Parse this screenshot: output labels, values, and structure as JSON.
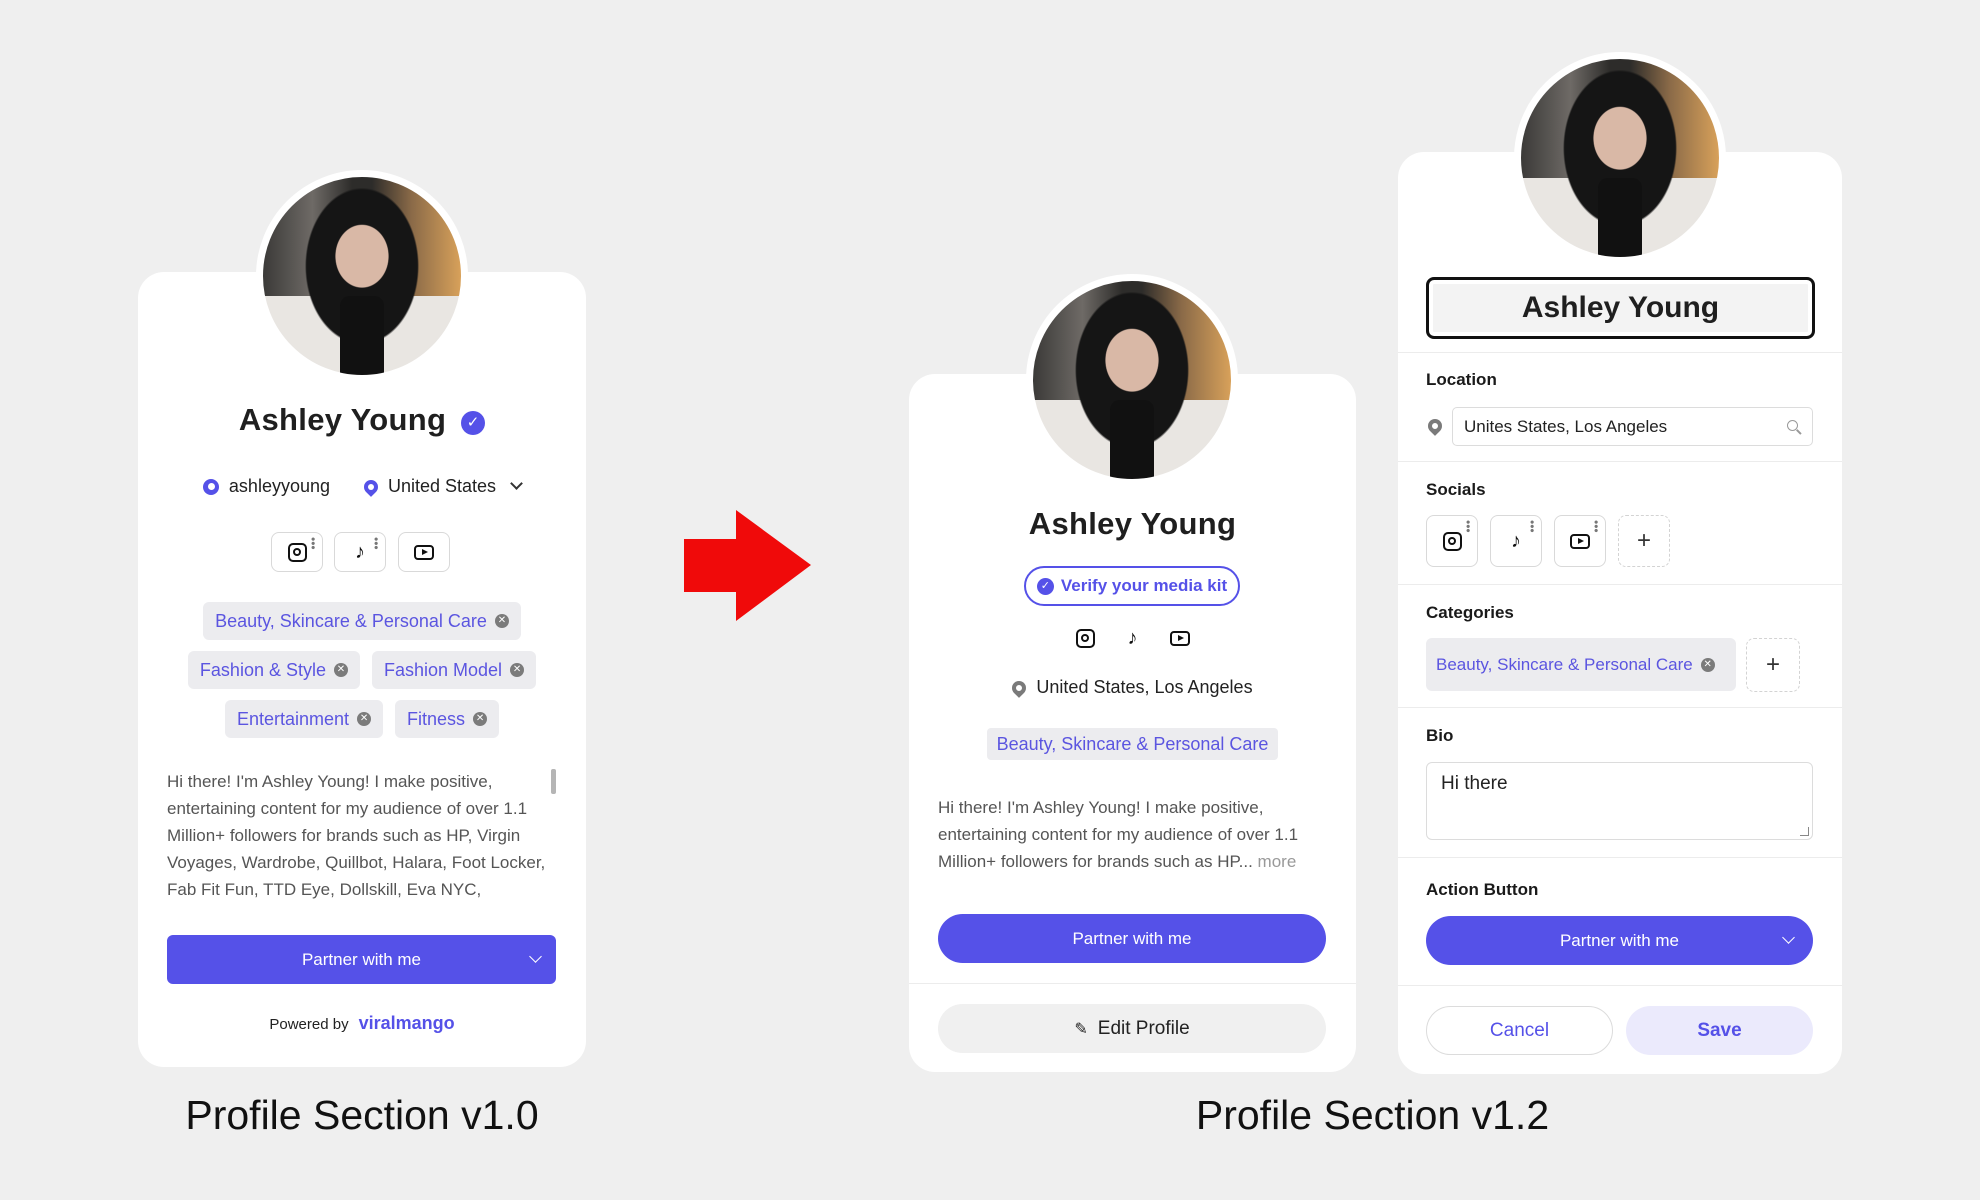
{
  "v1": {
    "name": "Ashley Young",
    "username": "ashleyyoung",
    "country": "United States",
    "categories": [
      "Beauty, Skincare & Personal Care",
      "Fashion & Style",
      "Fashion Model",
      "Entertainment",
      "Fitness"
    ],
    "bio": "Hi there! I'm Ashley Young! I make positive, entertaining content for my audience of over 1.1 Million+ followers for brands such as HP, Virgin Voyages, Wardrobe, Quillbot, Halara, Foot Locker, Fab Fit Fun, TTD Eye, Dollskill, Eva NYC,",
    "action_button": "Partner with me",
    "powered_by": "Powered by",
    "brand": "viralmango",
    "caption": "Profile Section v1.0"
  },
  "v12_view": {
    "name": "Ashley Young",
    "verify_label": "Verify your media kit",
    "location": "United States, Los Angeles",
    "category": "Beauty, Skincare & Personal Care",
    "bio": "Hi there! I'm Ashley Young! I make positive, entertaining content for my audience of over 1.1 Million+ followers for brands such as HP...",
    "more_label": "more",
    "action_button": "Partner with me",
    "edit_button": "Edit Profile"
  },
  "v12_edit": {
    "name_value": "Ashley Young",
    "location_label": "Location",
    "location_value": "Unites States, Los Angeles",
    "socials_label": "Socials",
    "categories_label": "Categories",
    "category": "Beauty, Skincare & Personal Care",
    "bio_label": "Bio",
    "bio_value": "Hi there",
    "action_label": "Action Button",
    "action_value": "Partner with me",
    "cancel": "Cancel",
    "save": "Save"
  },
  "caption_v12": "Profile Section v1.2",
  "colors": {
    "accent": "#5551e8",
    "chip_text": "#5b55e0",
    "arrow": "#f00a0a",
    "background": "#efefef"
  }
}
